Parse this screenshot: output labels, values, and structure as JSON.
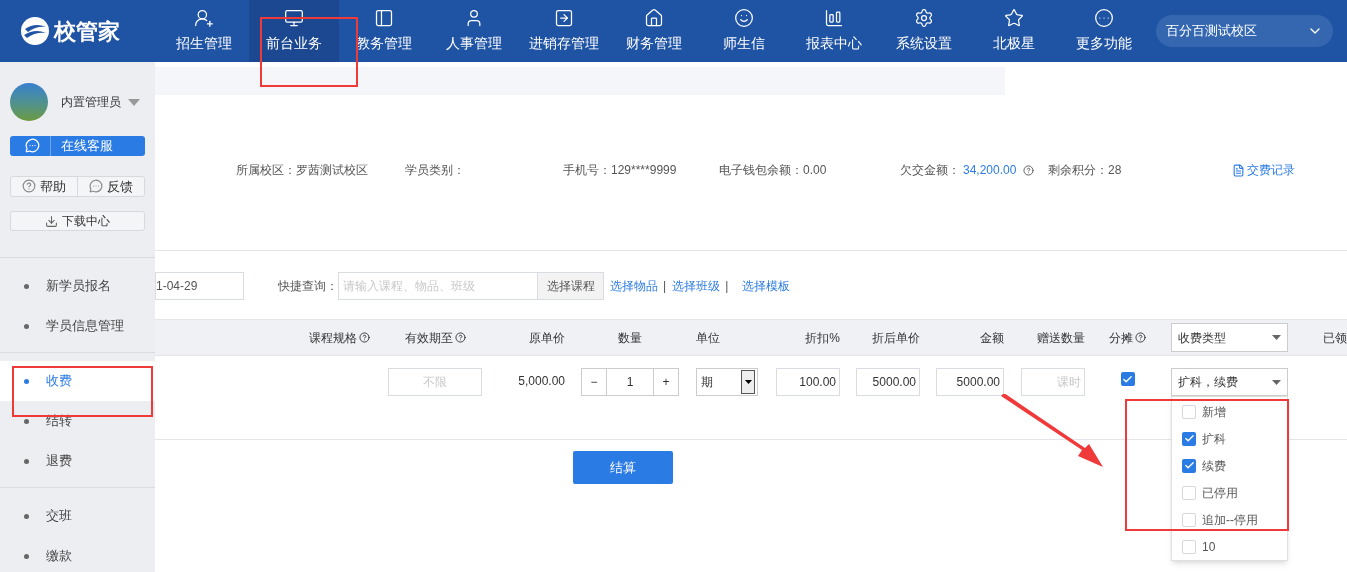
{
  "header": {
    "logo": "校管家",
    "nav": [
      {
        "label": "招生管理",
        "selected": false
      },
      {
        "label": "前台业务",
        "selected": true
      },
      {
        "label": "教务管理",
        "selected": false
      },
      {
        "label": "人事管理",
        "selected": false
      },
      {
        "label": "进销存管理",
        "selected": false
      },
      {
        "label": "财务管理",
        "selected": false
      },
      {
        "label": "师生信",
        "selected": false
      },
      {
        "label": "报表中心",
        "selected": false
      },
      {
        "label": "系统设置",
        "selected": false
      },
      {
        "label": "北极星",
        "selected": false
      },
      {
        "label": "更多功能",
        "selected": false
      }
    ],
    "campus": "百分百测试校区"
  },
  "sidebar": {
    "user_name": "内置管理员",
    "service_button": "在线客服",
    "help_button": "帮助",
    "feedback_button": "反馈",
    "download_button": "下载中心",
    "menu_groups": [
      [
        {
          "label": "新学员报名",
          "selected": false
        },
        {
          "label": "学员信息管理",
          "selected": false
        }
      ],
      [
        {
          "label": "收费",
          "selected": true
        },
        {
          "label": "结转",
          "selected": false
        },
        {
          "label": "退费",
          "selected": false
        }
      ],
      [
        {
          "label": "交班",
          "selected": false
        },
        {
          "label": "缴款",
          "selected": false
        }
      ]
    ]
  },
  "info": {
    "campus": "所属校区：罗茜测试校区",
    "student_type": "学员类别：",
    "phone": "手机号：129****9999",
    "wallet": "电子钱包余额：0.00",
    "arrears_label": "欠交金额：",
    "arrears_value": "34,200.00",
    "points": "剩余积分：28",
    "record_link": "交费记录"
  },
  "search": {
    "date": "1-04-29",
    "quick_label": "快捷查询：",
    "placeholder": "请输入课程、物品、班级",
    "select_course_button": "选择课程",
    "links": [
      "选择物品",
      "选择班级",
      "选择模板"
    ],
    "separator": "|"
  },
  "table": {
    "columns": [
      {
        "label": "课程规格",
        "help": true,
        "kind": "text"
      },
      {
        "label": "有效期至",
        "help": true,
        "kind": "text"
      },
      {
        "label": "原单价",
        "help": false,
        "kind": "text"
      },
      {
        "label": "数量",
        "help": false,
        "kind": "text"
      },
      {
        "label": "单位",
        "help": false,
        "kind": "text"
      },
      {
        "label": "折扣%",
        "help": false,
        "kind": "text"
      },
      {
        "label": "折后单价",
        "help": false,
        "kind": "text"
      },
      {
        "label": "金额",
        "help": false,
        "kind": "text"
      },
      {
        "label": "赠送数量",
        "help": false,
        "kind": "text"
      },
      {
        "label": "分摊",
        "help": true,
        "kind": "text"
      },
      {
        "label": "收费类型",
        "help": false,
        "kind": "select"
      },
      {
        "label": "已领",
        "help": false,
        "kind": "text"
      }
    ],
    "row": {
      "validity_placeholder": "不限",
      "price": "5,000.00",
      "minus": "−",
      "quantity": "1",
      "plus": "+",
      "unit": "期",
      "discount": "100.00",
      "net_price": "5000.00",
      "amount": "5000.00",
      "gift_placeholder": "课时",
      "split_checked": true,
      "fee_type": "扩科，续费"
    }
  },
  "fee_type_options": [
    {
      "label": "新增",
      "checked": false
    },
    {
      "label": "扩科",
      "checked": true
    },
    {
      "label": "续费",
      "checked": true
    },
    {
      "label": "已停用",
      "checked": false
    },
    {
      "label": "追加--停用",
      "checked": false
    },
    {
      "label": "10",
      "checked": false
    }
  ],
  "checkout_button": "结算"
}
